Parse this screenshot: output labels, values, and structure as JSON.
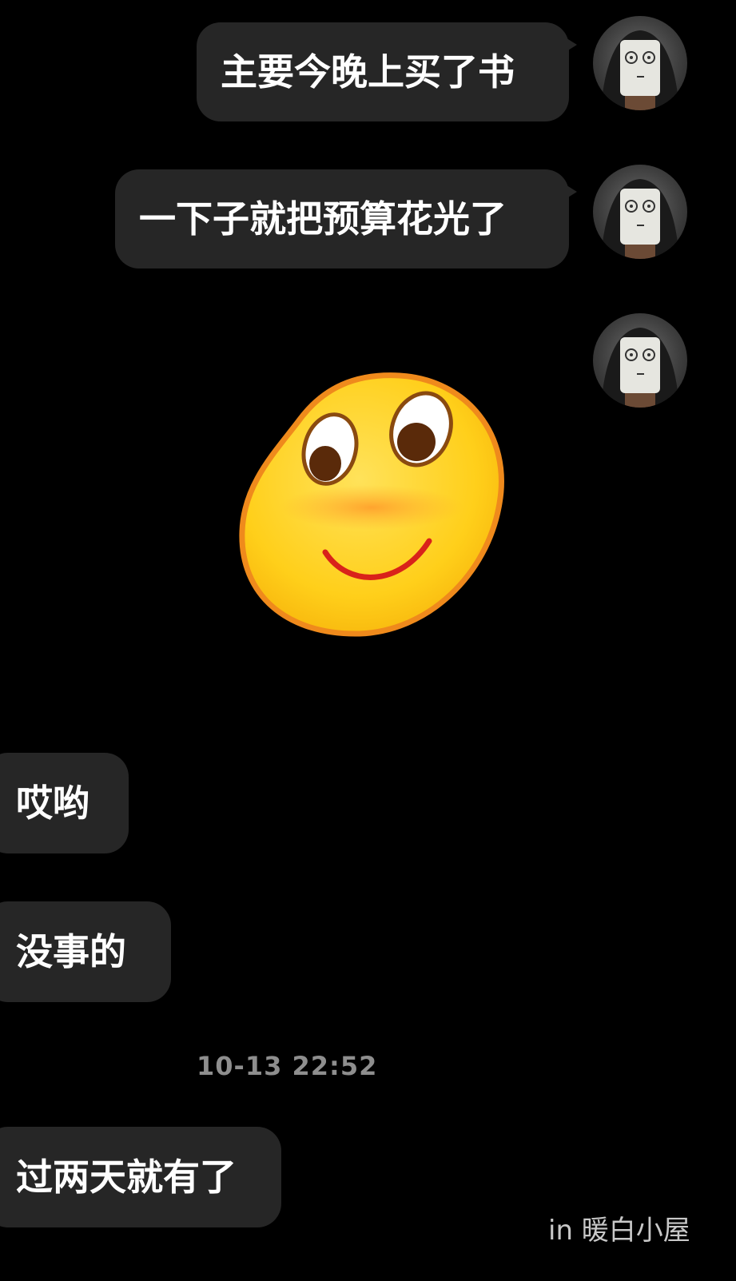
{
  "messages": [
    {
      "direction": "out",
      "text": "主要今晚上买了书"
    },
    {
      "direction": "out",
      "text": "一下子就把预算花光了"
    },
    {
      "direction": "out",
      "sticker": "smiling-blob-emoji"
    },
    {
      "direction": "in",
      "text": "哎哟"
    },
    {
      "direction": "in",
      "text": "没事的"
    },
    {
      "direction": "in",
      "text": "过两天就有了"
    }
  ],
  "timestamp": "10-13 22:52",
  "watermark": "in 暖白小屋",
  "avatar_icon": "masked-person-avatar",
  "colors": {
    "background": "#000000",
    "bubble": "#262626",
    "text": "#ffffff",
    "timestamp": "#8e8e8e"
  }
}
